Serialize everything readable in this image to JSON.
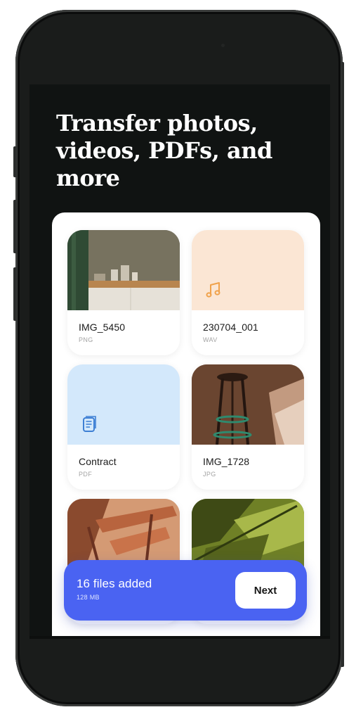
{
  "header": {
    "title": "Transfer photos, videos, PDFs, and more"
  },
  "files": [
    {
      "name": "IMG_5450",
      "type": "PNG",
      "thumbnail": "kitchen-photo"
    },
    {
      "name": "230704_001",
      "type": "WAV",
      "thumbnail": "music-note-icon"
    },
    {
      "name": "Contract",
      "type": "PDF",
      "thumbnail": "document-icon"
    },
    {
      "name": "IMG_1728",
      "type": "JPG",
      "thumbnail": "stool-photo"
    },
    {
      "name": "",
      "type": "",
      "thumbnail": "chair-photo"
    },
    {
      "name": "",
      "type": "",
      "thumbnail": "leaf-photo"
    }
  ],
  "summary": {
    "count_label": "16 files added",
    "size_label": "128 MB",
    "next_label": "Next"
  },
  "colors": {
    "screen_background": "#101312",
    "accent": "#4a63f2",
    "audio_tile": "#fbe6d4",
    "audio_icon": "#f0a24b",
    "document_tile": "#d3e8fb",
    "document_icon": "#3d7fd4"
  }
}
